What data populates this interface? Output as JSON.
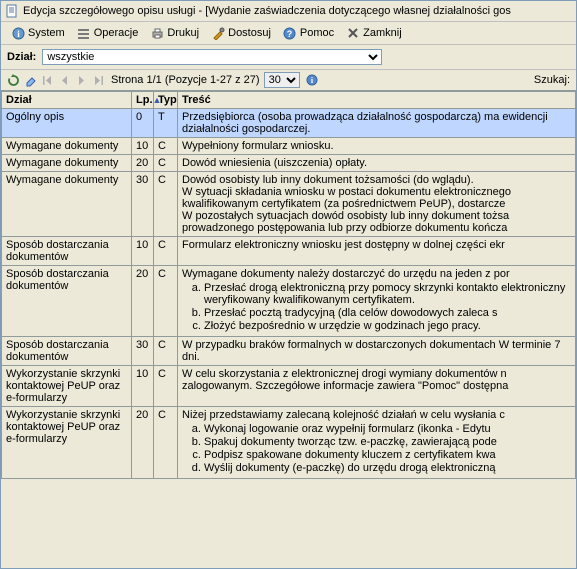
{
  "window": {
    "title": "Edycja szczegółowego opisu usługi - [Wydanie zaświadczenia dotyczącego własnej działalności gos"
  },
  "menu": {
    "system": "System",
    "operacje": "Operacje",
    "drukuj": "Drukuj",
    "dostosuj": "Dostosuj",
    "pomoc": "Pomoc",
    "zamknij": "Zamknij"
  },
  "filter": {
    "label": "Dział:",
    "value": "wszystkie"
  },
  "toolbar": {
    "page_text": "Strona 1/1 (Pozycje 1-27 z 27)",
    "page_size": "30",
    "search_label": "Szukaj:"
  },
  "table": {
    "headers": {
      "dzial": "Dział",
      "lp": "Lp.",
      "typ": "Typ",
      "tresc": "Treść"
    },
    "rows": [
      {
        "dzial": "Ogólny opis",
        "lp": "0",
        "typ": "T",
        "tresc": "Przedsiębiorca (osoba prowadząca działalność gospodarczą) ma ewidencji działalności gospodarczej.",
        "highlight": true
      },
      {
        "dzial": "Wymagane dokumenty",
        "lp": "10",
        "typ": "C",
        "tresc": "Wypełniony formularz wniosku."
      },
      {
        "dzial": "Wymagane dokumenty",
        "lp": "20",
        "typ": "C",
        "tresc": "Dowód wniesienia (uiszczenia) opłaty."
      },
      {
        "dzial": "Wymagane dokumenty",
        "lp": "30",
        "typ": "C",
        "tresc": "Dowód osobisty lub inny dokument tożsamości (do wglądu).\nW sytuacji składania wniosku w postaci dokumentu elektronicznego kwalifikowanym certyfikatem (za pośrednictwem PeUP), dostarcze\nW pozostałych sytuacjach dowód osobisty lub inny dokument tożsa prowadzonego postępowania lub przy odbiorze dokumentu kończa"
      },
      {
        "dzial": "Sposób dostarczania dokumentów",
        "lp": "10",
        "typ": "C",
        "tresc": "Formularz elektroniczny wniosku jest dostępny w dolnej części ekr"
      },
      {
        "dzial": "Sposób dostarczania dokumentów",
        "lp": "20",
        "typ": "C",
        "tresc": "Wymagane dokumenty należy dostarczyć do urzędu na jeden z por",
        "items": [
          "Przesłać drogą elektroniczną przy pomocy skrzynki kontakto elektroniczny weryfikowany kwalifikowanym certyfikatem.",
          "Przesłać pocztą tradycyjną (dla celów dowodowych zaleca s",
          "Złożyć bezpośrednio w urzędzie w godzinach jego pracy."
        ]
      },
      {
        "dzial": "Sposób dostarczania dokumentów",
        "lp": "30",
        "typ": "C",
        "tresc": "W przypadku braków formalnych w dostarczonych dokumentach W terminie 7 dni."
      },
      {
        "dzial": "Wykorzystanie skrzynki kontaktowej PeUP oraz e-formularzy",
        "lp": "10",
        "typ": "C",
        "tresc": "W celu skorzystania z elektronicznej drogi wymiany dokumentów n zalogowanym. Szczegółowe informacje zawiera \"Pomoc\" dostępna"
      },
      {
        "dzial": "Wykorzystanie skrzynki kontaktowej PeUP oraz e-formularzy",
        "lp": "20",
        "typ": "C",
        "tresc": "Niżej przedstawiamy zalecaną kolejność działań w celu wysłania c",
        "items": [
          "Wykonaj logowanie oraz wypełnij formularz (ikonka - Edytu",
          "Spakuj dokumenty tworząc tzw. e-paczkę, zawierającą pode",
          "Podpisz spakowane dokumenty kluczem z certyfikatem kwa",
          "Wyślij dokumenty (e-paczkę) do urzędu drogą elektroniczną"
        ]
      }
    ]
  }
}
